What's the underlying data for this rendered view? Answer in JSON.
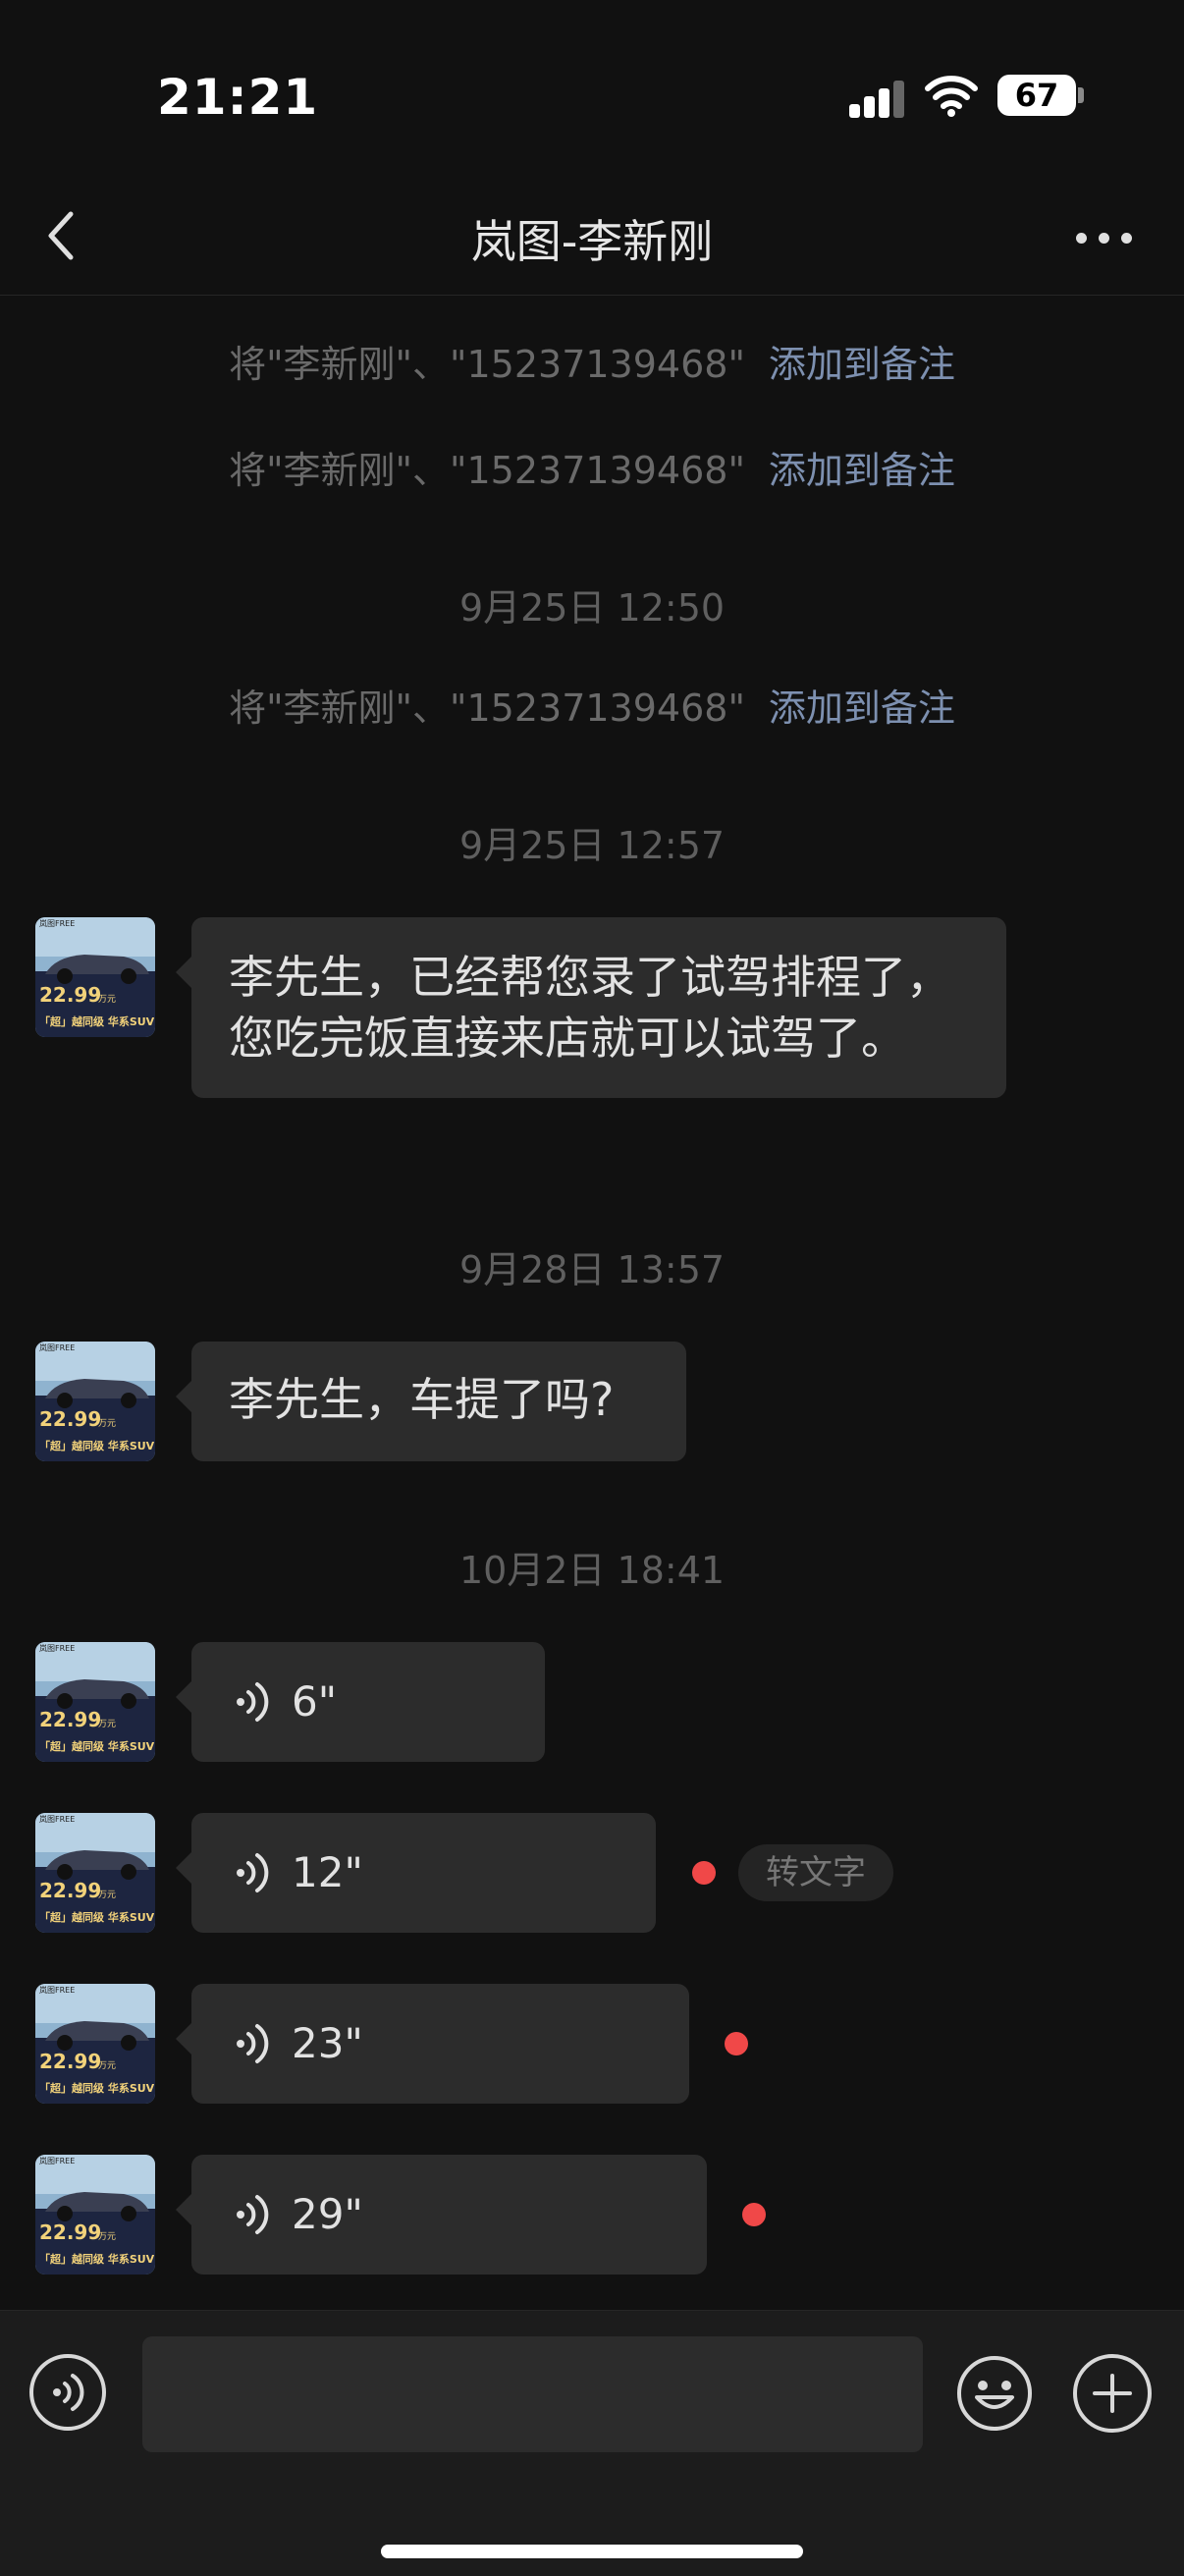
{
  "status_bar": {
    "time": "21:21",
    "battery": "67"
  },
  "header": {
    "title": "岚图-李新刚"
  },
  "messages": {
    "sys1_text": "将\"李新刚\"、\"15237139468\"",
    "sys1_link": "添加到备注",
    "sys2_text": "将\"李新刚\"、\"15237139468\"",
    "sys2_link": "添加到备注",
    "ts1": "9月25日 12:50",
    "sys3_text": "将\"李新刚\"、\"15237139468\"",
    "sys3_link": "添加到备注",
    "ts2": "9月25日 12:57",
    "msg1": "李先生，已经帮您录了试驾排程了，您吃完饭直接来店就可以试驾了。",
    "ts3": "9月28日 13:57",
    "msg2": "李先生，车提了吗?",
    "ts4": "10月2日 18:41",
    "voice1": "6\"",
    "voice2": "12\"",
    "convert_label": "转文字",
    "voice3": "23\"",
    "voice4": "29\""
  },
  "avatar": {
    "brand": "岚图FREE",
    "price": "22.99",
    "price_unit": "万元",
    "slogan": "「超」越同级 华系SUV"
  },
  "colors": {
    "background": "#111111",
    "bubble": "#2c2c2c",
    "link": "#7d90b0",
    "unread_dot": "#f04848"
  },
  "icons": {
    "back": "chevron-left-icon",
    "more": "more-dots-icon",
    "voice": "voice-wave-icon",
    "emoji": "emoji-icon",
    "plus": "plus-icon"
  }
}
